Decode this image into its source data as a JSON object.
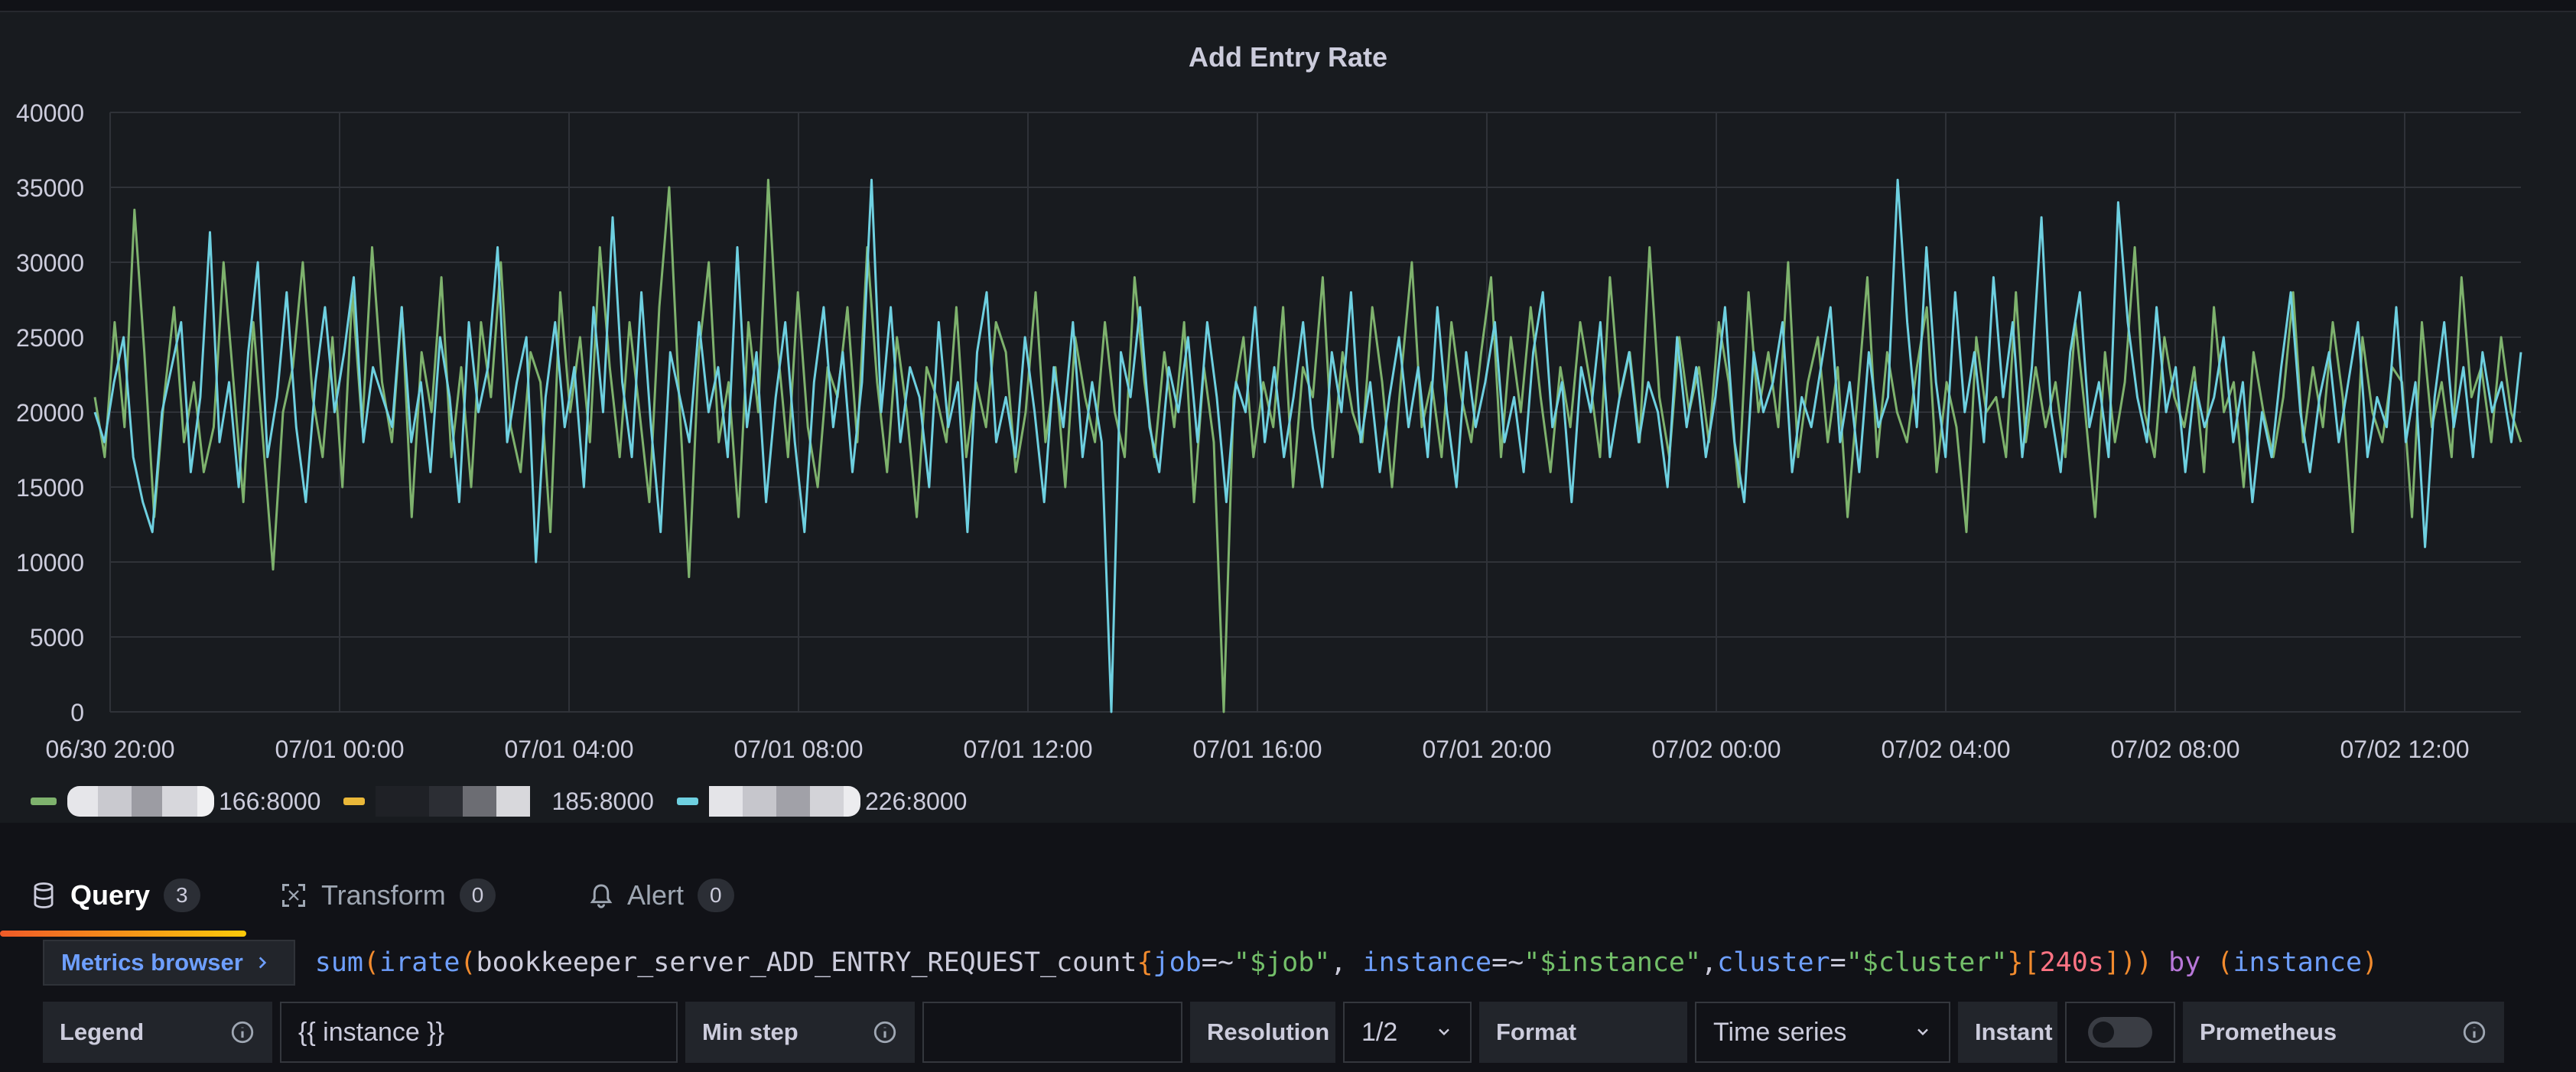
{
  "panel": {
    "title": "Add Entry Rate"
  },
  "chart_data": {
    "type": "line",
    "title": "Add Entry Rate",
    "xlabel": "",
    "ylabel": "",
    "ylim": [
      0,
      40000
    ],
    "y_ticks": [
      "0",
      "5000",
      "10000",
      "15000",
      "20000",
      "25000",
      "30000",
      "35000",
      "40000"
    ],
    "x_ticks": [
      "06/30 20:00",
      "07/01 00:00",
      "07/01 04:00",
      "07/01 08:00",
      "07/01 12:00",
      "07/01 16:00",
      "07/01 20:00",
      "07/02 00:00",
      "07/02 04:00",
      "07/02 08:00",
      "07/02 12:00"
    ],
    "grid": true,
    "legend_position": "bottom",
    "series": [
      {
        "name": "166:8000",
        "color": "#7eb26d",
        "values": [
          21000,
          17000,
          26000,
          19000,
          33500,
          24000,
          13000,
          21000,
          27000,
          18000,
          22000,
          16000,
          19000,
          30000,
          22000,
          14000,
          26000,
          18000,
          9500,
          20000,
          23000,
          30000,
          21000,
          17000,
          25000,
          15000,
          28000,
          19000,
          31000,
          22000,
          18000,
          27000,
          13000,
          24000,
          20000,
          29000,
          17000,
          23000,
          15000,
          26000,
          21000,
          30000,
          19000,
          16000,
          24000,
          22000,
          12000,
          28000,
          20000,
          25000,
          18000,
          31000,
          23000,
          17000,
          26000,
          20000,
          14000,
          27000,
          35000,
          21000,
          9000,
          24000,
          30000,
          18000,
          22000,
          13000,
          26000,
          20000,
          35500,
          24000,
          17000,
          28000,
          19000,
          15000,
          23000,
          21000,
          27000,
          18000,
          31000,
          22000,
          16000,
          25000,
          20000,
          13000,
          23000,
          21000,
          18000,
          27000,
          17000,
          22000,
          19000,
          26000,
          24000,
          16000,
          20000,
          28000,
          18000,
          23000,
          15000,
          25000,
          21000,
          18000,
          26000,
          20000,
          17000,
          29000,
          22000,
          17000,
          24000,
          19000,
          26000,
          14000,
          23000,
          18000,
          0,
          21000,
          25000,
          17000,
          22000,
          19000,
          27000,
          15000,
          23000,
          21000,
          29000,
          17000,
          24000,
          20000,
          18000,
          27000,
          22000,
          15000,
          23000,
          30000,
          19000,
          22000,
          17000,
          26000,
          21000,
          18000,
          24000,
          29000,
          17000,
          25000,
          20000,
          27000,
          21000,
          16000,
          23000,
          19000,
          26000,
          22000,
          17000,
          29000,
          21000,
          24000,
          18000,
          31000,
          21000,
          17000,
          25000,
          20000,
          23000,
          18000,
          26000,
          22000,
          15000,
          28000,
          20000,
          24000,
          19000,
          30000,
          17000,
          22000,
          25000,
          18000,
          23000,
          13000,
          21000,
          29000,
          17000,
          24000,
          20000,
          18000,
          23000,
          27000,
          16000,
          22000,
          19000,
          12000,
          25000,
          20000,
          21000,
          17000,
          28000,
          18000,
          23000,
          19000,
          22000,
          17000,
          26000,
          20000,
          13000,
          24000,
          18000,
          22000,
          31000,
          20000,
          17000,
          25000,
          21000,
          19000,
          23000,
          16000,
          27000,
          20000,
          22000,
          15000,
          24000,
          20000,
          17000,
          21000,
          28000,
          18000,
          23000,
          19000,
          26000,
          21000,
          12000,
          25000,
          20000,
          18000,
          23000,
          22000,
          13000,
          26000,
          19000,
          22000,
          17000,
          29000,
          21000,
          23000,
          18000,
          25000,
          20000,
          18000
        ]
      },
      {
        "name": "185:8000",
        "color": "#eab839",
        "values": []
      },
      {
        "name": "226:8000",
        "color": "#6ed0e0",
        "values": [
          20000,
          18000,
          22000,
          25000,
          17000,
          14000,
          12000,
          20000,
          23000,
          26000,
          16000,
          21000,
          32000,
          18000,
          22000,
          15000,
          24000,
          30000,
          17000,
          21000,
          28000,
          19000,
          14000,
          22000,
          27000,
          20000,
          24000,
          29000,
          18000,
          23000,
          21000,
          19000,
          27000,
          18000,
          22000,
          16000,
          25000,
          21000,
          14000,
          26000,
          20000,
          23000,
          31000,
          18000,
          22000,
          25000,
          10000,
          21000,
          26000,
          19000,
          23000,
          15000,
          27000,
          20000,
          33000,
          22000,
          17000,
          28000,
          19000,
          12000,
          24000,
          21000,
          18000,
          26000,
          20000,
          23000,
          17000,
          31000,
          19000,
          24000,
          14000,
          21000,
          26000,
          18000,
          12000,
          22000,
          27000,
          19000,
          24000,
          16000,
          22000,
          35500,
          20000,
          27000,
          18000,
          23000,
          21000,
          15000,
          26000,
          19000,
          22000,
          12000,
          24000,
          28000,
          18000,
          21000,
          17000,
          25000,
          20000,
          14000,
          23000,
          19000,
          26000,
          17000,
          22000,
          18000,
          0,
          24000,
          21000,
          27000,
          19000,
          16000,
          23000,
          20000,
          25000,
          18000,
          26000,
          21000,
          14000,
          22000,
          20000,
          27000,
          18000,
          23000,
          17000,
          21000,
          26000,
          19000,
          15000,
          24000,
          20000,
          28000,
          18000,
          22000,
          16000,
          21000,
          25000,
          19000,
          23000,
          17000,
          27000,
          20000,
          15000,
          24000,
          19000,
          22000,
          26000,
          18000,
          21000,
          16000,
          24000,
          28000,
          19000,
          22000,
          14000,
          23000,
          20000,
          26000,
          17000,
          21000,
          24000,
          18000,
          22000,
          20000,
          15000,
          25000,
          19000,
          23000,
          17000,
          21000,
          27000,
          18000,
          14000,
          24000,
          20000,
          22000,
          26000,
          16000,
          21000,
          19000,
          23000,
          27000,
          18000,
          22000,
          16000,
          24000,
          19000,
          21000,
          35500,
          26000,
          19000,
          31000,
          22000,
          17000,
          28000,
          20000,
          24000,
          18000,
          29000,
          21000,
          26000,
          17000,
          23000,
          33000,
          20000,
          16000,
          24000,
          28000,
          19000,
          22000,
          17000,
          34000,
          26000,
          21000,
          18000,
          27000,
          20000,
          23000,
          16000,
          22000,
          19000,
          21000,
          25000,
          18000,
          22000,
          14000,
          20000,
          17000,
          23000,
          28000,
          20000,
          16000,
          21000,
          24000,
          18000,
          22000,
          26000,
          17000,
          21000,
          19000,
          27000,
          18000,
          22000,
          11000,
          21000,
          26000,
          19000,
          23000,
          17000,
          24000,
          20000,
          22000,
          18000,
          24000
        ]
      }
    ]
  },
  "legend": [
    {
      "label": "166:8000",
      "color": "#7eb26d"
    },
    {
      "label": "185:8000",
      "color": "#eab839"
    },
    {
      "label": "226:8000",
      "color": "#6ed0e0"
    }
  ],
  "tabs": {
    "query": {
      "label": "Query",
      "count": "3",
      "icon": "database-icon"
    },
    "transform": {
      "label": "Transform",
      "count": "0",
      "icon": "transform-icon"
    },
    "alert": {
      "label": "Alert",
      "count": "0",
      "icon": "bell-icon"
    }
  },
  "query": {
    "metrics_browser": "Metrics browser",
    "tokens": [
      {
        "t": "sum",
        "c": "c-fn"
      },
      {
        "t": "(",
        "c": "c-brace"
      },
      {
        "t": "irate",
        "c": "c-fn"
      },
      {
        "t": "(",
        "c": "c-brace"
      },
      {
        "t": "bookkeeper_server_ADD_ENTRY_REQUEST_count",
        "c": "c-metric"
      },
      {
        "t": "{",
        "c": "c-brace"
      },
      {
        "t": "job",
        "c": "c-label"
      },
      {
        "t": "=~",
        "c": "c-op"
      },
      {
        "t": "\"$job\"",
        "c": "c-str"
      },
      {
        "t": ", ",
        "c": "c-op"
      },
      {
        "t": "instance",
        "c": "c-label"
      },
      {
        "t": "=~",
        "c": "c-op"
      },
      {
        "t": "\"$instance\"",
        "c": "c-str"
      },
      {
        "t": ",",
        "c": "c-op"
      },
      {
        "t": "cluster",
        "c": "c-label"
      },
      {
        "t": "=",
        "c": "c-op"
      },
      {
        "t": "\"$cluster\"",
        "c": "c-str"
      },
      {
        "t": "}",
        "c": "c-brace"
      },
      {
        "t": "[",
        "c": "c-brace"
      },
      {
        "t": "240s",
        "c": "c-range"
      },
      {
        "t": "]",
        "c": "c-brace"
      },
      {
        "t": ")",
        "c": "c-brace"
      },
      {
        "t": ")",
        "c": "c-brace"
      },
      {
        "t": " by ",
        "c": "c-kw"
      },
      {
        "t": "(",
        "c": "c-brace"
      },
      {
        "t": "instance",
        "c": "c-label"
      },
      {
        "t": ")",
        "c": "c-brace"
      }
    ]
  },
  "options": {
    "legend_label": "Legend",
    "legend_value": "{{ instance }}",
    "min_step_label": "Min step",
    "min_step_value": "",
    "resolution_label": "Resolution",
    "resolution_value": "1/2",
    "format_label": "Format",
    "format_value": "Time series",
    "instant_label": "Instant",
    "instant_on": false,
    "datasource_label": "Prometheus"
  }
}
